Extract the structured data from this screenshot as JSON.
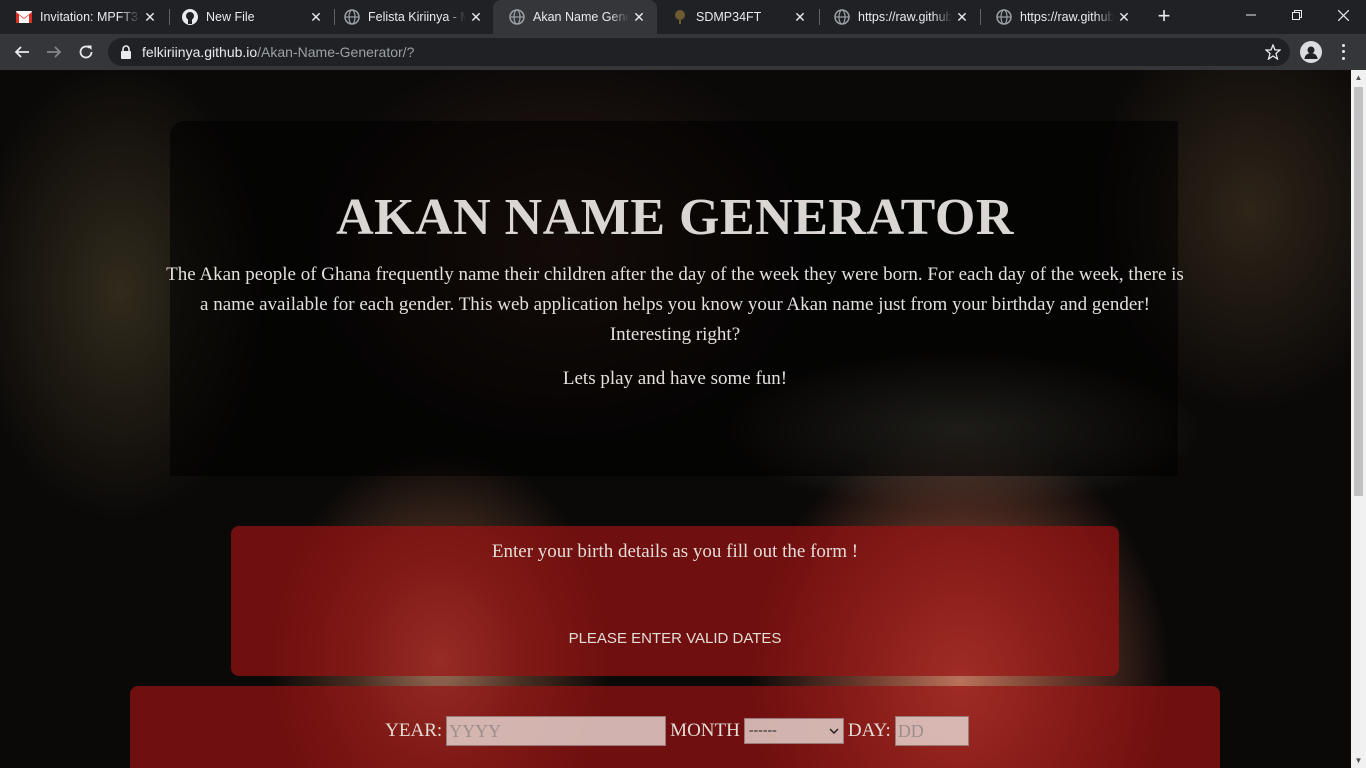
{
  "browser": {
    "tabs": [
      {
        "title": "Invitation: MPFT34",
        "icon": "gmail-icon"
      },
      {
        "title": "New File",
        "icon": "github-icon"
      },
      {
        "title": "Felista Kiriinya - M",
        "icon": "globe-icon"
      },
      {
        "title": "Akan Name Gener",
        "icon": "globe-icon",
        "active": true
      },
      {
        "title": "SDMP34FT",
        "icon": "tree-icon"
      },
      {
        "title": "https://raw.githubu",
        "icon": "globe-icon"
      },
      {
        "title": "https://raw.githubu",
        "icon": "globe-icon"
      }
    ],
    "url_host": "felkiriinya.github.io",
    "url_path": "/Akan-Name-Generator/?"
  },
  "page": {
    "title": "AKAN NAME GENERATOR",
    "intro": "The Akan people of Ghana frequently name their children after the day of the week they were born. For each day of the week, there is a name available for each gender. This web application helps you know your Akan name just from your birthday and gender! Interesting right?",
    "fun": "Lets play and have some fun!",
    "form_heading": "Enter your birth details as you fill out the form !",
    "form_error": "PLEASE ENTER VALID DATES",
    "year_label": "YEAR:",
    "year_placeholder": "YYYY",
    "month_label": "MONTH",
    "month_selected": "------",
    "day_label": "DAY:",
    "day_placeholder": "DD"
  },
  "colors": {
    "accent_box": "#961212",
    "browser_dark": "#202124",
    "toolbar": "#35363a"
  }
}
